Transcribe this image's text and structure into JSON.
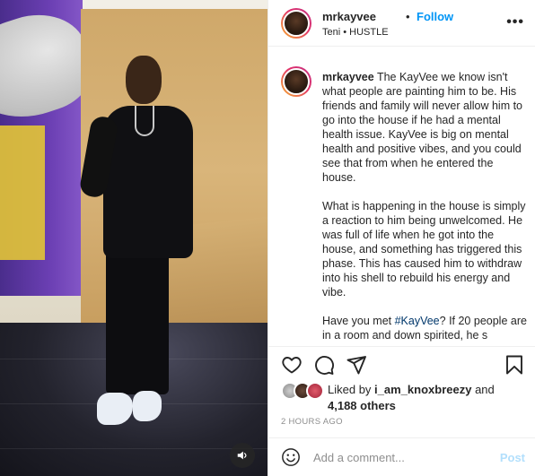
{
  "header": {
    "username": "mrkayvee",
    "separator": "•",
    "follow_label": "Follow",
    "subtitle": "Teni • HUSTLE",
    "more_label": "•••"
  },
  "caption": {
    "username": "mrkayvee",
    "paragraph1": "The KayVee we know isn't what people are painting him to be. His friends and family will never allow him to go into the house if he had a mental health issue. KayVee is big on mental health and positive vibes, and you could see that from when he entered the house.",
    "paragraph2": "What is happening in the house is simply a reaction to him being unwelcomed. He was full of life when he got into the house, and something has triggered this phase. This has caused him to withdraw into his shell to rebuild his energy and vibe.",
    "paragraph3_pre": "Have you met ",
    "paragraph3_hashtag": "#KayVee",
    "paragraph3_post": "? If 20 people are in a room and down spirited, he s"
  },
  "likes": {
    "prefix": "Liked by ",
    "user": "i_am_knoxbreezy",
    "middle": " and",
    "others": "4,188 others"
  },
  "timestamp": "2 HOURS AGO",
  "comment": {
    "placeholder": "Add a comment...",
    "post_label": "Post"
  },
  "icons": {
    "like": "heart-icon",
    "comment": "comment-icon",
    "share": "share-icon",
    "save": "bookmark-icon",
    "emoji": "emoji-icon",
    "mute": "speaker-icon"
  },
  "colors": {
    "accent": "#0095f6",
    "hashtag": "#00376b",
    "muted": "#8e8e8e",
    "post_disabled": "#b2dffc"
  }
}
